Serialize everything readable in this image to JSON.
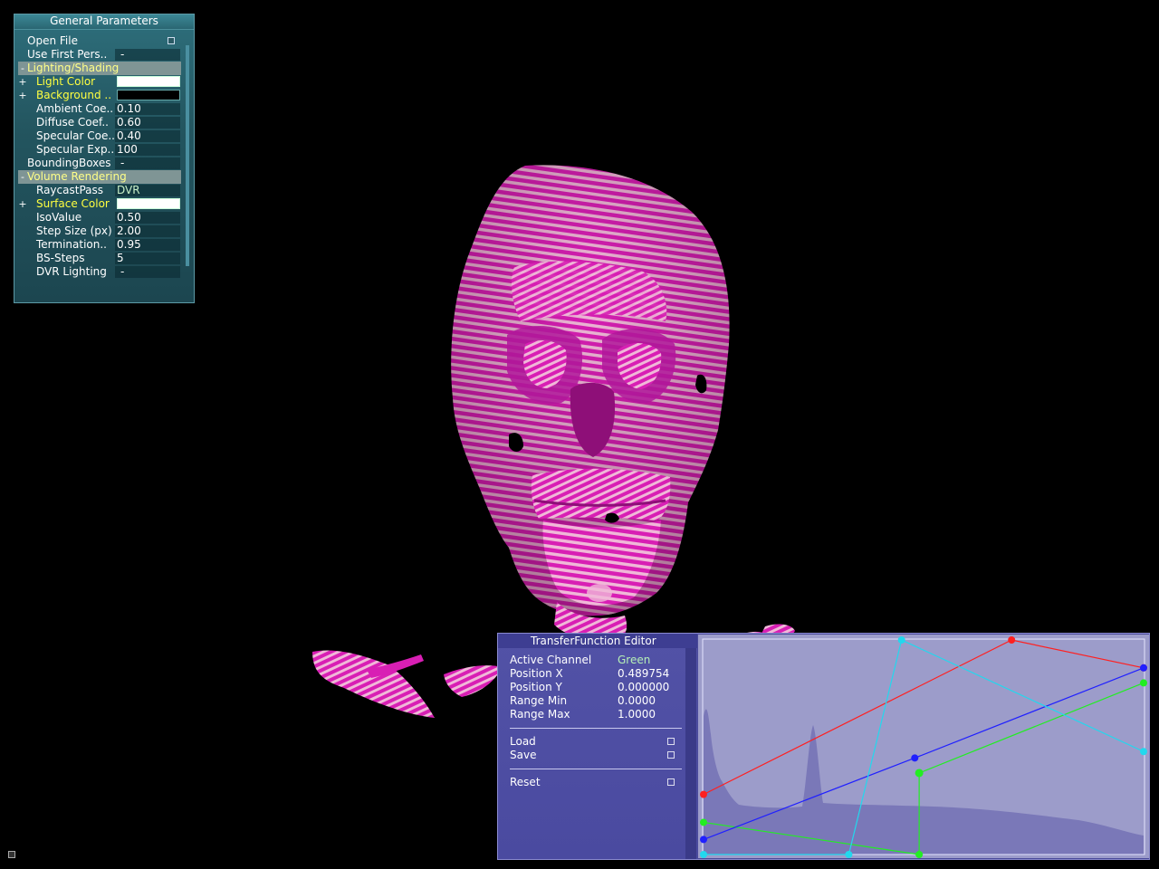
{
  "general_parameters": {
    "title": "General Parameters",
    "rows": [
      {
        "label": "Open File",
        "kind": "checkbox"
      },
      {
        "label": "Use First Pers..",
        "value": "-"
      },
      {
        "label": "Lighting/Shading",
        "kind": "section",
        "toggle": "-"
      },
      {
        "label": "Light Color",
        "kind": "color",
        "toggle": "+",
        "color": "#ffffff"
      },
      {
        "label": "Background ..",
        "kind": "color",
        "toggle": "+",
        "color": "#000000"
      },
      {
        "label": "Ambient Coe..",
        "value": "0.10"
      },
      {
        "label": "Diffuse Coef..",
        "value": "0.60"
      },
      {
        "label": "Specular Coe..",
        "value": "0.40"
      },
      {
        "label": "Specular Exp..",
        "value": "100"
      },
      {
        "label": "BoundingBoxes",
        "value": "-"
      },
      {
        "label": "Volume Rendering",
        "kind": "section",
        "toggle": "-"
      },
      {
        "label": "RaycastPass",
        "value": "DVR"
      },
      {
        "label": "Surface Color",
        "kind": "color",
        "toggle": "+",
        "color": "#ffffff"
      },
      {
        "label": "IsoValue",
        "value": "0.50"
      },
      {
        "label": "Step Size (px)",
        "value": "2.00"
      },
      {
        "label": "Termination..",
        "value": "0.95"
      },
      {
        "label": "BS-Steps",
        "value": "5"
      },
      {
        "label": "DVR Lighting",
        "value": "-"
      }
    ]
  },
  "transfer_function_editor": {
    "title": "TransferFunction Editor",
    "active_channel_label": "Active Channel",
    "active_channel_value": "Green",
    "position_x_label": "Position X",
    "position_x_value": "0.489754",
    "position_y_label": "Position Y",
    "position_y_value": "0.000000",
    "range_min_label": "Range Min",
    "range_min_value": "0.0000",
    "range_max_label": "Range Max",
    "range_max_value": "1.0000",
    "load_label": "Load",
    "save_label": "Save",
    "reset_label": "Reset",
    "channels": [
      {
        "name": "red",
        "color": "#ff2020",
        "points": [
          [
            0.0,
            0.28
          ],
          [
            0.7,
            1.0
          ],
          [
            1.0,
            0.87
          ]
        ]
      },
      {
        "name": "green",
        "color": "#22ee22",
        "points": [
          [
            0.0,
            0.15
          ],
          [
            0.49,
            0.0
          ],
          [
            0.49,
            0.38
          ],
          [
            1.0,
            0.8
          ]
        ]
      },
      {
        "name": "blue",
        "color": "#2020ff",
        "points": [
          [
            0.0,
            0.07
          ],
          [
            0.48,
            0.45
          ],
          [
            1.0,
            0.87
          ]
        ]
      },
      {
        "name": "alpha",
        "color": "#22d8ee",
        "points": [
          [
            0.0,
            0.0
          ],
          [
            0.33,
            0.0
          ],
          [
            0.45,
            1.0
          ],
          [
            1.0,
            0.48
          ]
        ]
      }
    ]
  },
  "colors": {
    "skull_magenta": "#d81fb4",
    "skull_pink": "#f0b8d8",
    "panel_teal": "#2e6f7c",
    "editor_blue": "#4a4a9a"
  }
}
